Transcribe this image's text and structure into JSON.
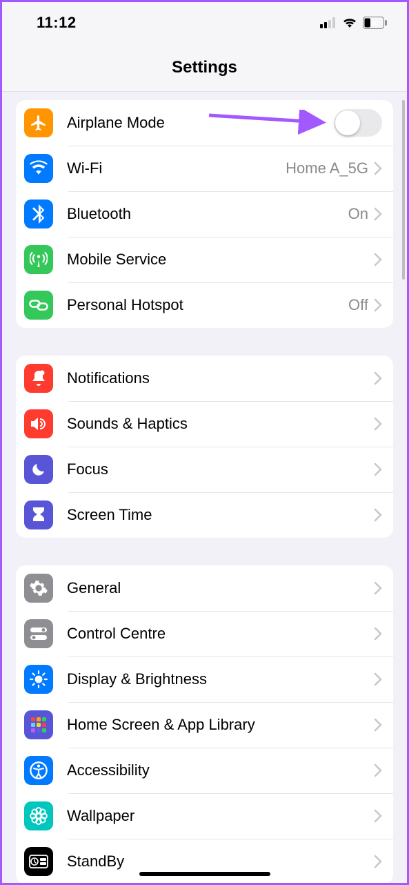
{
  "status": {
    "time": "11:12",
    "battery_pct": "30"
  },
  "header": {
    "title": "Settings"
  },
  "sections": {
    "network": {
      "airplane": {
        "label": "Airplane Mode",
        "toggled": false,
        "icon_bg": "#ff9500"
      },
      "wifi": {
        "label": "Wi-Fi",
        "detail": "Home A_5G",
        "icon_bg": "#007aff"
      },
      "bluetooth": {
        "label": "Bluetooth",
        "detail": "On",
        "icon_bg": "#007aff"
      },
      "mobile": {
        "label": "Mobile Service",
        "detail": "",
        "icon_bg": "#34c759"
      },
      "hotspot": {
        "label": "Personal Hotspot",
        "detail": "Off",
        "icon_bg": "#34c759"
      }
    },
    "notify": {
      "notifications": {
        "label": "Notifications",
        "icon_bg": "#ff3b30"
      },
      "sounds": {
        "label": "Sounds & Haptics",
        "icon_bg": "#ff3b30"
      },
      "focus": {
        "label": "Focus",
        "icon_bg": "#5856d6"
      },
      "screentime": {
        "label": "Screen Time",
        "icon_bg": "#5856d6"
      }
    },
    "general": {
      "general": {
        "label": "General",
        "icon_bg": "#8e8e93"
      },
      "control": {
        "label": "Control Centre",
        "icon_bg": "#8e8e93"
      },
      "display": {
        "label": "Display & Brightness",
        "icon_bg": "#007aff"
      },
      "home": {
        "label": "Home Screen & App Library",
        "icon_bg": "#5856d6"
      },
      "accessibility": {
        "label": "Accessibility",
        "icon_bg": "#007aff"
      },
      "wallpaper": {
        "label": "Wallpaper",
        "icon_bg": "#00c7be"
      },
      "standby": {
        "label": "StandBy",
        "icon_bg": "#000000"
      }
    }
  }
}
